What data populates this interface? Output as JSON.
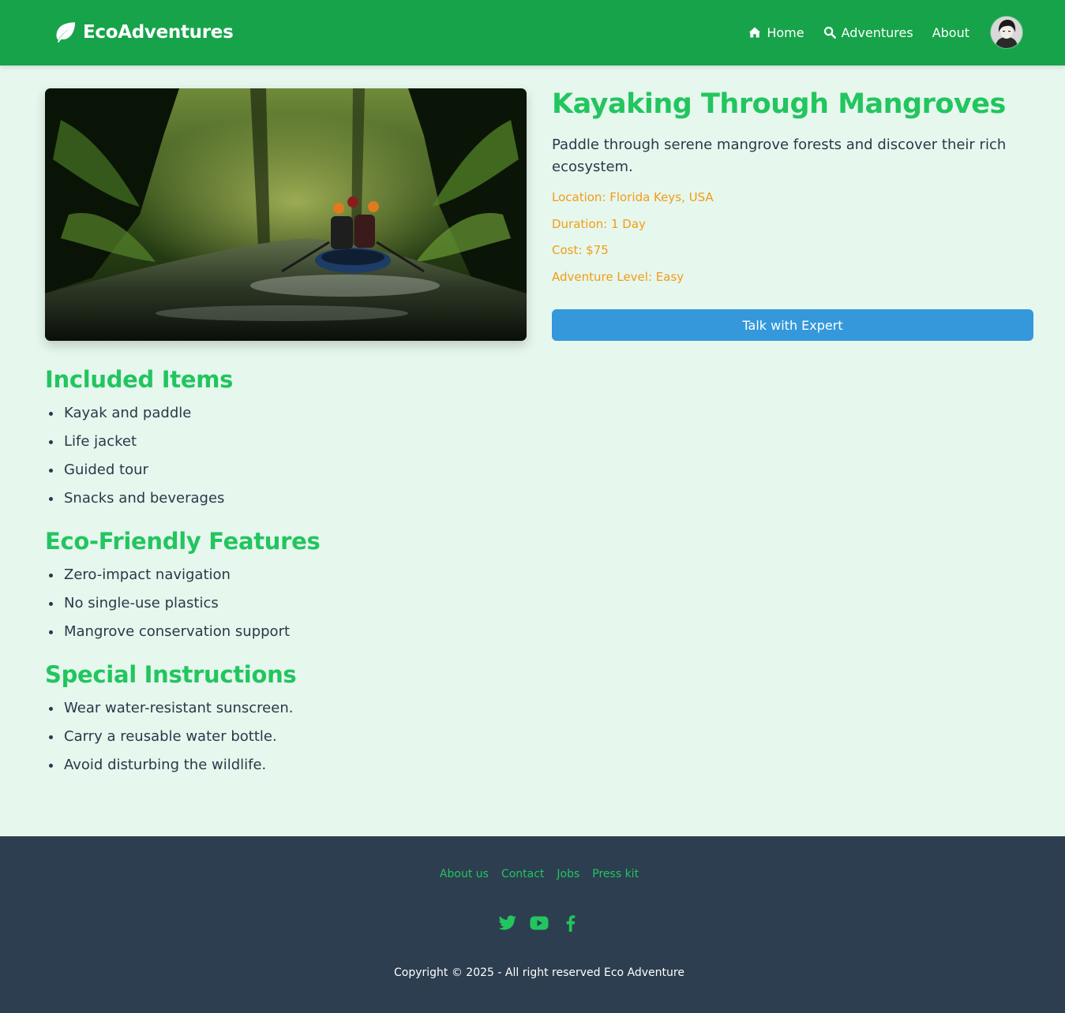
{
  "header": {
    "brand": "EcoAdventures",
    "nav": [
      {
        "label": "Home",
        "icon": "home-icon"
      },
      {
        "label": "Adventures",
        "icon": "search-icon"
      },
      {
        "label": "About",
        "icon": ""
      }
    ]
  },
  "adventure": {
    "title": "Kayaking Through Mangroves",
    "description": "Paddle through serene mangrove forests and discover their rich ecosystem.",
    "location": "Location: Florida Keys, USA",
    "duration": "Duration: 1 Day",
    "cost": "Cost: $75",
    "level": "Adventure Level: Easy",
    "cta": "Talk with Expert"
  },
  "sections": [
    {
      "title": "Included Items",
      "items": [
        "Kayak and paddle",
        "Life jacket",
        "Guided tour",
        "Snacks and beverages"
      ]
    },
    {
      "title": "Eco-Friendly Features",
      "items": [
        "Zero-impact navigation",
        "No single-use plastics",
        "Mangrove conservation support"
      ]
    },
    {
      "title": "Special Instructions",
      "items": [
        "Wear water-resistant sunscreen.",
        "Carry a reusable water bottle.",
        "Avoid disturbing the wildlife."
      ]
    }
  ],
  "footer": {
    "links": [
      "About us",
      "Contact",
      "Jobs",
      "Press kit"
    ],
    "social": [
      "twitter-icon",
      "youtube-icon",
      "facebook-icon"
    ],
    "copyright": "Copyright © 2025 - All right reserved Eco Adventure"
  },
  "colors": {
    "navbar": "#17a34a",
    "accent_green": "#22c55e",
    "meta_orange": "#f39c12",
    "button_blue": "#3498db",
    "page_bg": "#e6f7ee",
    "footer_bg": "#2d3e50"
  }
}
